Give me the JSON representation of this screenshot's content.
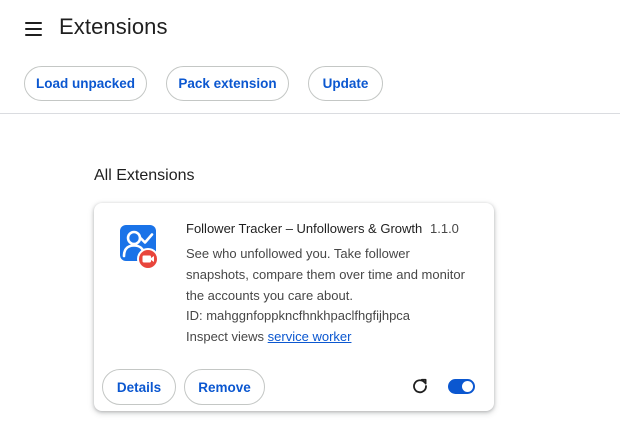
{
  "header": {
    "title": "Extensions",
    "menu_icon": "hamburger-menu-icon"
  },
  "toolbar": {
    "load_unpacked_label": "Load unpacked",
    "pack_extension_label": "Pack extension",
    "update_label": "Update"
  },
  "section": {
    "title": "All Extensions"
  },
  "extension": {
    "name": "Follower Tracker – Unfollowers & Growth",
    "version": "1.1.0",
    "description": "See who unfollowed you. Take follower snapshots, compare them over time and monitor the accounts you care about.",
    "id_text": "ID: mahggnfoppkncfhnkhpaclfhgfijhpca",
    "inspect_label": "Inspect views",
    "inspect_link": "service worker",
    "details_label": "Details",
    "remove_label": "Remove",
    "enabled": true,
    "icon": "user-check-icon",
    "reload_icon": "reload-icon"
  },
  "colors": {
    "accent": "#0b57d0",
    "icon_blue": "#1a73e8",
    "badge_red": "#e8453c"
  }
}
